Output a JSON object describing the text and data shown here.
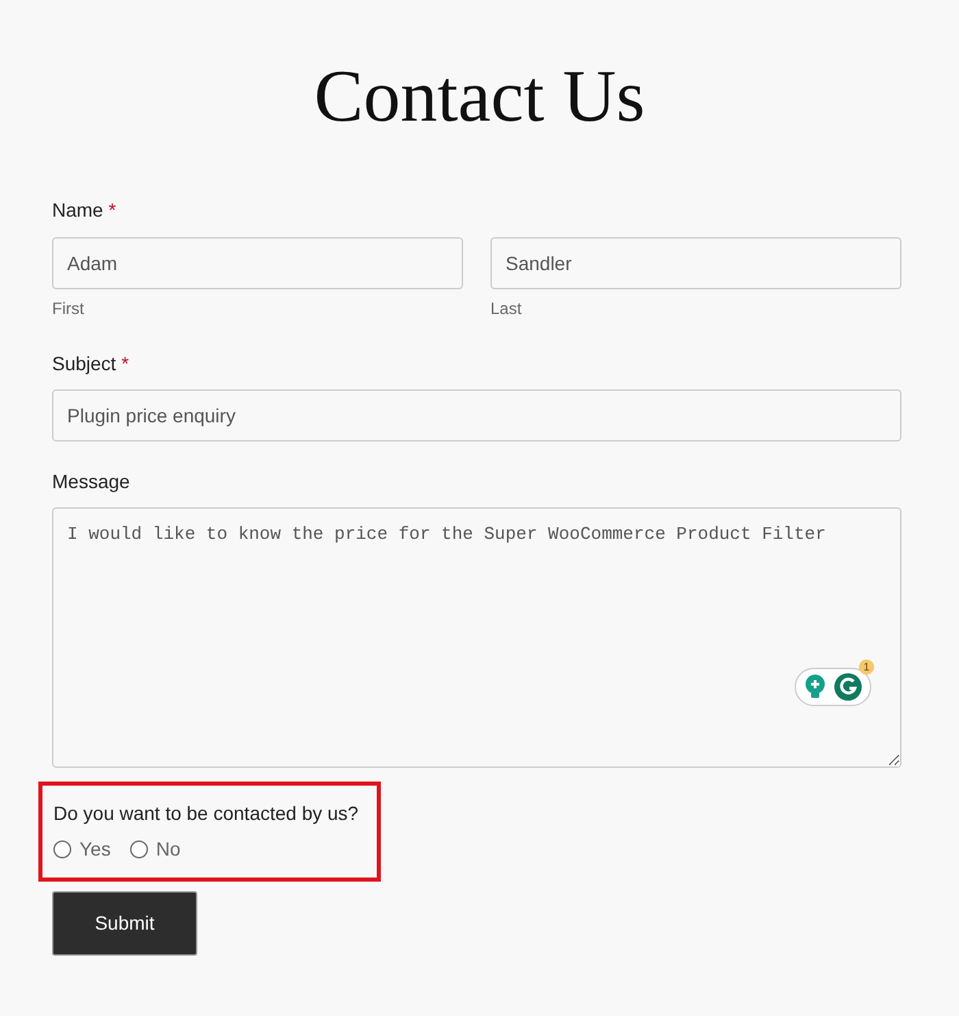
{
  "title": "Contact Us",
  "name_field": {
    "label": "Name",
    "required_mark": "*",
    "first": {
      "value": "Adam",
      "sublabel": "First"
    },
    "last": {
      "value": "Sandler",
      "sublabel": "Last"
    }
  },
  "subject_field": {
    "label": "Subject",
    "required_mark": "*",
    "value": "Plugin price enquiry"
  },
  "message_field": {
    "label": "Message",
    "value": "I would like to know the price for the Super WooCommerce Product Filter",
    "assistant_badge": "1"
  },
  "contact_question": {
    "label": "Do you want to be contacted by us?",
    "highlighted": true,
    "options": [
      {
        "label": "Yes",
        "selected": false
      },
      {
        "label": "No",
        "selected": false
      }
    ]
  },
  "submit": {
    "label": "Submit"
  }
}
